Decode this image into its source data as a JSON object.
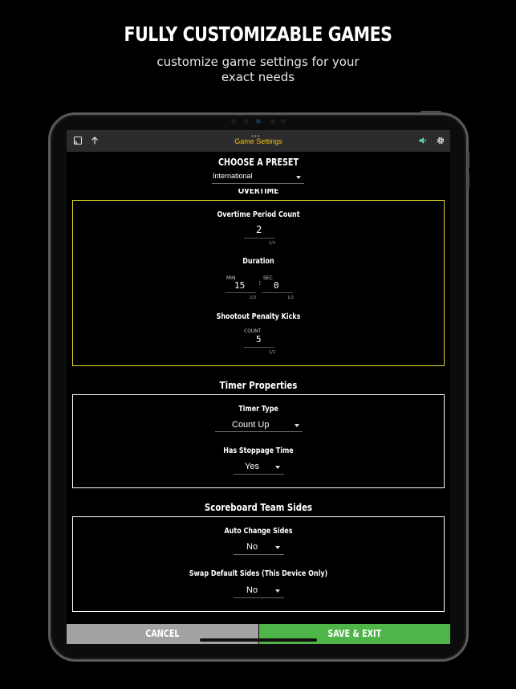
{
  "promo": {
    "headline": "FULLY CUSTOMIZABLE GAMES",
    "subline_1": "customize game settings for your",
    "subline_2": "exact needs"
  },
  "topbar": {
    "title": "Game Settings",
    "icons": [
      "cast-icon",
      "upload-arrow-icon",
      "speaker-icon",
      "gear-icon"
    ],
    "accent": "#f2c200"
  },
  "preset": {
    "heading": "CHOOSE A PRESET",
    "selected": "International"
  },
  "overtime": {
    "heading": "OVERTIME",
    "border_color": "#e6d62a",
    "period_count": {
      "label": "Overtime Period Count",
      "value": "2",
      "digits_hint": "1/2"
    },
    "duration": {
      "label": "Duration",
      "min_caption": "MIN",
      "min_value": "15",
      "min_hint": "2/3",
      "separator": ":",
      "sec_caption": "SEC",
      "sec_value": "0",
      "sec_hint": "1/2"
    },
    "shootout": {
      "label": "Shootout Penalty Kicks",
      "caption": "COUNT",
      "value": "5",
      "digits_hint": "1/2"
    }
  },
  "timer": {
    "heading": "Timer Properties",
    "timer_type": {
      "label": "Timer Type",
      "value": "Count Up"
    },
    "stoppage": {
      "label": "Has Stoppage Time",
      "value": "Yes"
    }
  },
  "sides": {
    "heading": "Scoreboard Team Sides",
    "auto_change": {
      "label": "Auto Change Sides",
      "value": "No"
    },
    "swap_default": {
      "label": "Swap Default Sides (This Device Only)",
      "value": "No"
    }
  },
  "actions": {
    "cancel": "CANCEL",
    "save": "SAVE & EXIT",
    "save_color": "#4fb548",
    "cancel_color": "#a2a2a2"
  }
}
